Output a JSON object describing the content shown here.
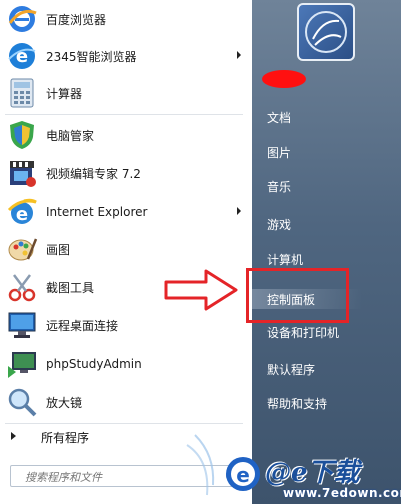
{
  "start_menu": {
    "programs": [
      {
        "label": "百度浏览器",
        "icon": "baidu-browser-icon",
        "has_submenu": false
      },
      {
        "label": "2345智能浏览器",
        "icon": "browser-2345-icon",
        "has_submenu": true
      },
      {
        "label": "计算器",
        "icon": "calculator-icon",
        "has_submenu": false
      },
      {
        "label": "电脑管家",
        "icon": "pc-manager-shield-icon",
        "has_submenu": false
      },
      {
        "label": "视频编辑专家 7.2",
        "icon": "video-editor-icon",
        "has_submenu": false
      },
      {
        "label": "Internet Explorer",
        "icon": "internet-explorer-icon",
        "has_submenu": true
      },
      {
        "label": "画图",
        "icon": "paint-icon",
        "has_submenu": false
      },
      {
        "label": "截图工具",
        "icon": "snipping-tool-icon",
        "has_submenu": false
      },
      {
        "label": "远程桌面连接",
        "icon": "remote-desktop-icon",
        "has_submenu": false
      },
      {
        "label": "phpStudyAdmin",
        "icon": "phpstudy-icon",
        "has_submenu": false
      },
      {
        "label": "放大镜",
        "icon": "magnifier-icon",
        "has_submenu": false
      }
    ],
    "all_programs_label": "所有程序",
    "search_placeholder": "搜索程序和文件"
  },
  "right_pane": {
    "items": [
      {
        "label": "文档"
      },
      {
        "label": "图片"
      },
      {
        "label": "音乐"
      },
      {
        "label": "游戏"
      },
      {
        "label": "计算机"
      },
      {
        "label": "控制面板"
      },
      {
        "label": "设备和打印机"
      },
      {
        "label": "默认程序"
      },
      {
        "label": "帮助和支持"
      }
    ],
    "highlighted": "控制面板"
  },
  "annotation": {
    "color": "#e42428"
  },
  "watermark": {
    "brand": "@e下载",
    "domain": "www.7edown.com"
  }
}
